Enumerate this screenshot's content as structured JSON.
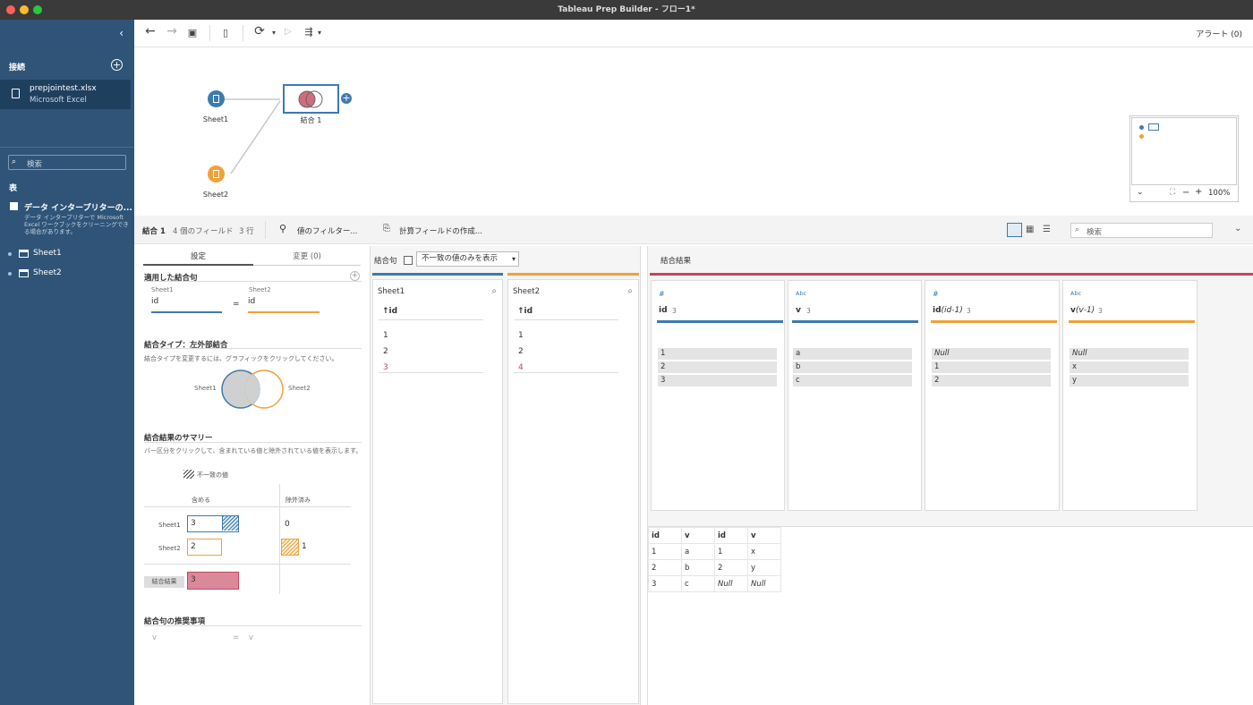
{
  "window": {
    "title": "Tableau Prep Builder - フロー1*"
  },
  "sidebar": {
    "collapse_icon": "chevron-left-icon",
    "connections_title": "接続",
    "connection": {
      "name": "prepjointest.xlsx",
      "type": "Microsoft Excel"
    },
    "search_placeholder": "検索",
    "tables_title": "表",
    "interpreter": {
      "title": "データ インタープリターの...",
      "desc": "データ インタープリターで Microsoft Excel ワークブックをクリーニングできる場合があります。"
    },
    "tables": [
      {
        "label": "Sheet1"
      },
      {
        "label": "Sheet2"
      }
    ]
  },
  "toolbar": {
    "alerts": "アラート (0)"
  },
  "flow": {
    "nodes": [
      {
        "label": "Sheet1",
        "color": "#3d7ab0"
      },
      {
        "label": "Sheet2",
        "color": "#f0a13a"
      }
    ],
    "join_label": "結合 1",
    "minimap_zoom": "100%"
  },
  "profile": {
    "step_name": "結合 1",
    "field_count": "4 個のフィールド",
    "row_count": "3 行",
    "filter_label": "値のフィルター...",
    "calc_label": "計算フィールドの作成...",
    "search_placeholder": "検索"
  },
  "settings": {
    "tabs": {
      "settings": "設定",
      "changes": "変更 (0)"
    },
    "applied_title": "適用した結合句",
    "clause": {
      "left_table": "Sheet1",
      "right_table": "Sheet2",
      "left_field": "id",
      "op": "=",
      "right_field": "id"
    },
    "join_type_title": "結合タイプ：左外部結合",
    "join_type_hint": "結合タイプを変更するには、グラフィックをクリックしてください。",
    "venn": {
      "left": "Sheet1",
      "right": "Sheet2"
    },
    "summary_title": "結合結果のサマリー",
    "summary_hint": "バー区分をクリックして、含まれている値と除外されている値を表示します。",
    "mismatch_legend": "不一致の値",
    "col_included": "含める",
    "col_excluded": "除外済み",
    "rows": [
      {
        "label": "Sheet1",
        "included": "3",
        "excluded": "0"
      },
      {
        "label": "Sheet2",
        "included": "2",
        "excluded": "1"
      }
    ],
    "result_label": "結合結果",
    "result_value": "3",
    "recommend_title": "結合句の推奨事項",
    "recommend": {
      "left": "v",
      "op": "=",
      "right": "v"
    }
  },
  "clauses": {
    "label": "結合句",
    "dropdown": "不一致の値のみを表示",
    "cols": [
      {
        "table": "Sheet1",
        "field": "id",
        "values": [
          "1",
          "2",
          "3"
        ],
        "mismatch": [
          false,
          false,
          true
        ]
      },
      {
        "table": "Sheet2",
        "field": "id",
        "values": [
          "1",
          "2",
          "4"
        ],
        "mismatch": [
          false,
          false,
          true
        ]
      }
    ]
  },
  "result": {
    "title": "結合結果",
    "profiles": [
      {
        "type": "#",
        "name": "id",
        "suffix": "",
        "count": "3",
        "color": "#3d7ab0",
        "values": [
          "1",
          "2",
          "3"
        ]
      },
      {
        "type": "Abc",
        "name": "v",
        "suffix": "",
        "count": "3",
        "color": "#3d7ab0",
        "values": [
          "a",
          "b",
          "c"
        ]
      },
      {
        "type": "#",
        "name": "id",
        "suffix": "(id-1)",
        "count": "3",
        "color": "#f0a13a",
        "values": [
          "Null",
          "1",
          "2"
        ]
      },
      {
        "type": "Abc",
        "name": "v",
        "suffix": "(v-1)",
        "count": "3",
        "color": "#f0a13a",
        "values": [
          "Null",
          "x",
          "y"
        ]
      }
    ],
    "grid": {
      "headers": [
        "id",
        "v",
        "id",
        "v"
      ],
      "rows": [
        [
          "1",
          "a",
          "1",
          "x"
        ],
        [
          "2",
          "b",
          "2",
          "y"
        ],
        [
          "3",
          "c",
          "Null",
          "Null"
        ]
      ]
    }
  }
}
